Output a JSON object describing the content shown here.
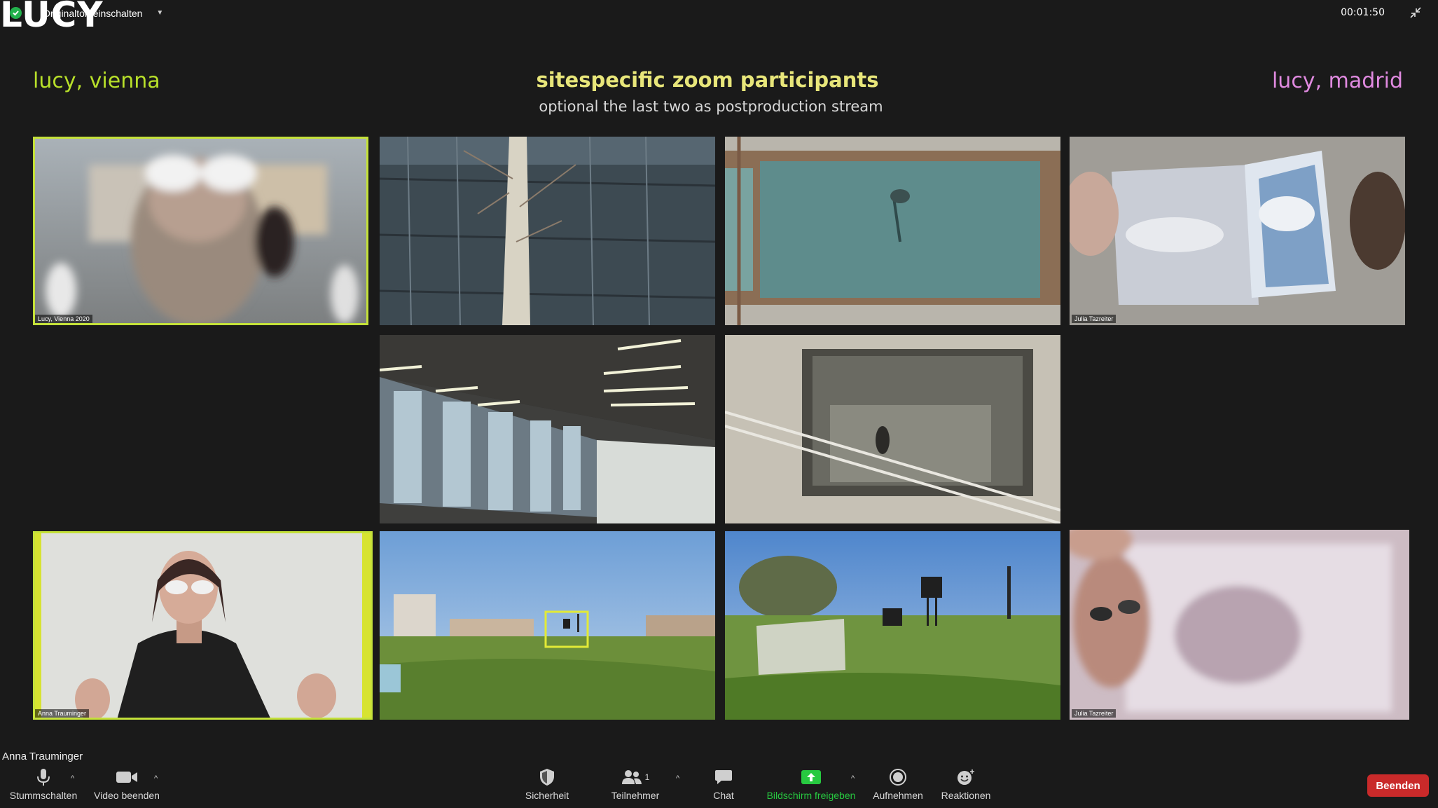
{
  "top": {
    "logo": "LUCY",
    "original_sound_label": "Originalton einschalten",
    "timer": "00:01:50"
  },
  "header": {
    "left_label": "lucy, vienna",
    "title": "sitespecific zoom participants",
    "subtitle": "optional the last two as postproduction stream",
    "right_label": "lucy, madrid"
  },
  "tiles": {
    "t1_name": "Lucy, Vienna 2020",
    "t4_name": "Julia Tazreiter",
    "t7_name": "Anna Trauminger",
    "t10_name": "Julia Tazreiter"
  },
  "active_speaker": "Anna Trauminger",
  "toolbar": {
    "mute": "Stummschalten",
    "video": "Video beenden",
    "security": "Sicherheit",
    "participants": "Teilnehmer",
    "participants_count": "1",
    "chat": "Chat",
    "share": "Bildschirm freigeben",
    "record": "Aufnehmen",
    "reactions": "Reaktionen",
    "end": "Beenden"
  },
  "colors": {
    "background": "#1a1a1a",
    "vienna_label": "#b8e02a",
    "madrid_label": "#e08ae0",
    "title": "#e8e67a",
    "active_outline": "#c4e13a",
    "share_green": "#27c940",
    "end_red": "#c92a2a"
  }
}
